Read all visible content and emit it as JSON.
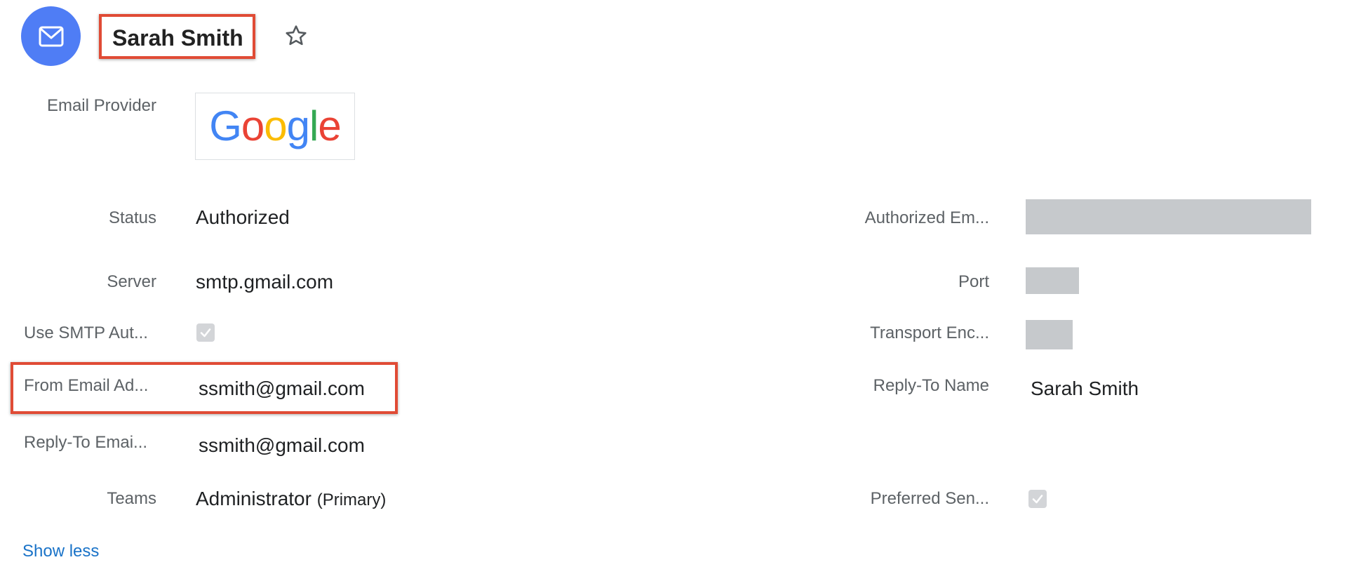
{
  "header": {
    "icon": "envelope-icon",
    "title": "Sarah Smith",
    "favorite_icon": "star-outline-icon",
    "accent_color": "#4f7df5",
    "highlight_color": "#e04b35"
  },
  "fields": {
    "email_provider": {
      "label": "Email Provider",
      "logo_text": "Google"
    },
    "status": {
      "label": "Status",
      "value": "Authorized"
    },
    "authorized_email": {
      "label": "Authorized Em..."
    },
    "server": {
      "label": "Server",
      "value": "smtp.gmail.com"
    },
    "port": {
      "label": "Port"
    },
    "use_smtp_auth": {
      "label": "Use SMTP Aut...",
      "checked": true
    },
    "transport_encryption": {
      "label": "Transport Enc..."
    },
    "from_email": {
      "label": "From Email Ad...",
      "value": "ssmith@gmail.com"
    },
    "reply_to_name": {
      "label": "Reply-To Name",
      "value": "Sarah Smith"
    },
    "reply_to_email": {
      "label": "Reply-To Emai...",
      "value": "ssmith@gmail.com"
    },
    "teams": {
      "label": "Teams",
      "value": "Administrator",
      "suffix": "(Primary)"
    },
    "preferred_sender": {
      "label": "Preferred Sen...",
      "checked": true
    }
  },
  "footer": {
    "toggle_label": "Show less"
  }
}
